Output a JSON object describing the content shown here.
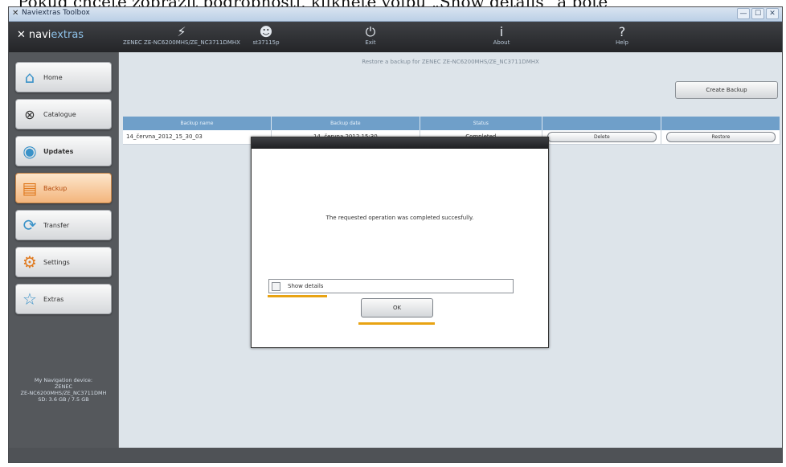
{
  "caption": "Pokud chcete zobrazit podrobnosti, klikněte volbu „Show details“ a poté",
  "window": {
    "title": "Naviextras Toolbox",
    "buttons": [
      "—",
      "☐",
      "✕"
    ]
  },
  "brand": {
    "name_a": "navi",
    "name_b": "extras"
  },
  "toolbar": {
    "device_label": "ZENEC ZE-NC6200MHS/ZE_NC3711DMHX",
    "user_label": "st37115p",
    "exit_label": "Exit",
    "about_label": "About",
    "help_label": "Help"
  },
  "sidebar": {
    "items": [
      {
        "label": "Home",
        "icon": "home-icon"
      },
      {
        "label": "Catalogue",
        "icon": "catalogue-icon"
      },
      {
        "label": "Updates",
        "icon": "updates-icon"
      },
      {
        "label": "Backup",
        "icon": "backup-icon"
      },
      {
        "label": "Transfer",
        "icon": "transfer-icon"
      },
      {
        "label": "Settings",
        "icon": "settings-icon"
      },
      {
        "label": "Extras",
        "icon": "extras-icon"
      }
    ],
    "device_info": {
      "line1": "My Navigation device:",
      "line2": "ZENEC",
      "line3": "ZE-NC6200MHS/ZE_NC3711DMH",
      "line4": "SD: 3.6 GB / 7.5 GB"
    }
  },
  "main": {
    "title": "Restore a backup for ZENEC ZE-NC6200MHS/ZE_NC3711DMHX",
    "create_button": "Create Backup",
    "table": {
      "headers": [
        "Backup name",
        "Backup date",
        "Status",
        "",
        ""
      ],
      "rows": [
        {
          "name": "14_června_2012_15_30_03",
          "date": "14. června 2012 15:30",
          "status": "Completed",
          "delete": "Delete",
          "restore": "Restore"
        }
      ]
    }
  },
  "dialog": {
    "message": "The requested operation was completed succesfully.",
    "details_label": "Show details",
    "ok_label": "OK"
  },
  "colors": {
    "accent_underline": "#e8a313",
    "table_header": "#6f9fc9",
    "active_nav": "#f3b57c"
  }
}
